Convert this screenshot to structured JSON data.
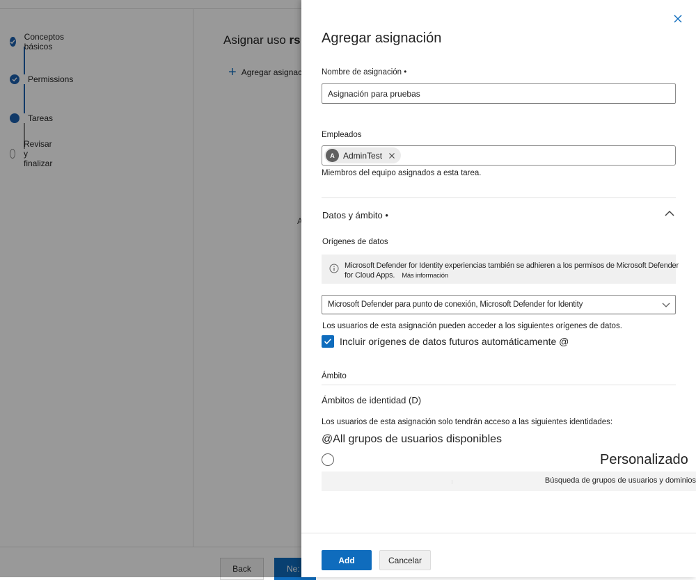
{
  "wizard": {
    "steps": [
      {
        "label": "Conceptos básicos",
        "state": "done"
      },
      {
        "label": "Permissions",
        "state": "done"
      },
      {
        "label": "Tareas",
        "state": "current"
      },
      {
        "label": "Revisar y finalizar",
        "state": "todo"
      }
    ],
    "title_prefix": "Asignar uso",
    "title_bold": "rs",
    "add_assignment_label": "Agregar asignación",
    "stray_letter": "A",
    "back_label": "Back",
    "next_label": "Ne:"
  },
  "panel": {
    "title": "Agregar asignación",
    "close_icon": "close-icon",
    "assignment_name": {
      "label": "Nombre de asignación •",
      "value": "Asignación para pruebas"
    },
    "employees": {
      "label": "Empleados",
      "chip": {
        "initial": "A",
        "name": "AdminTest"
      },
      "help": "Miembros del equipo asignados a esta tarea."
    },
    "data_scope": {
      "header": "Datos y ámbito •",
      "sources_label": "Orígenes de datos",
      "info_text": "Microsoft Defender for Identity experiencias también se adhieren a los permisos de Microsoft Defender for Cloud Apps.",
      "info_link": "Más información",
      "select_value": "Microsoft Defender para punto de conexión, Microsoft Defender for Identity",
      "sources_help": "Los usuarios de esta asignación pueden acceder a los siguientes orígenes de datos.",
      "include_future_label": "Incluir orígenes de datos futuros automáticamente @",
      "include_future_checked": true
    },
    "scope": {
      "label": "Ámbito",
      "identity_label": "Ámbitos de identidad (D)",
      "identity_help": "Los usuarios de esta asignación solo tendrán acceso a las siguientes identidades:",
      "all_groups": "@All grupos de usuarios disponibles",
      "custom": "Personalizado",
      "search_placeholder": "Búsqueda de grupos de usuarios y dominios"
    },
    "add_label": "Add",
    "cancel_label": "Cancelar"
  },
  "colors": {
    "accent": "#0f6cbd",
    "step": "#1c5fad",
    "overlay": "rgba(0,0,0,0.4)"
  }
}
